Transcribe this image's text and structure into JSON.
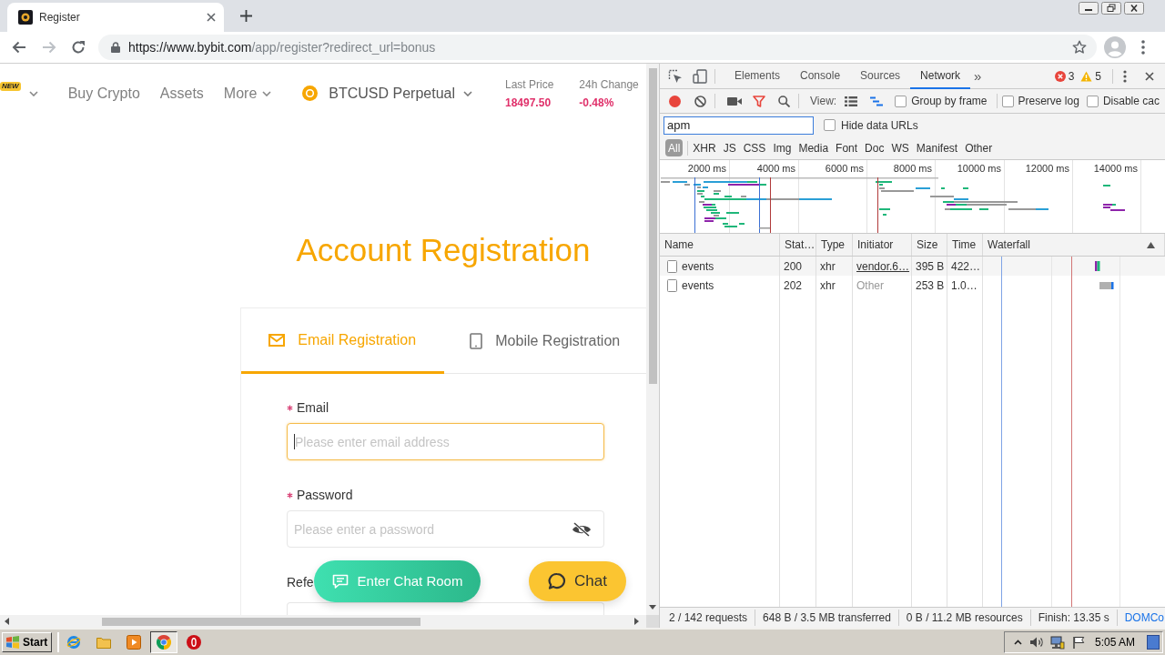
{
  "browser": {
    "tab": {
      "title": "Register"
    },
    "address": {
      "origin": "https://www.bybit.com",
      "path": "/app/register?redirect_url=bonus"
    }
  },
  "site_header": {
    "badge": "NEW",
    "links": [
      {
        "label": "Buy Crypto",
        "dropdown": false
      },
      {
        "label": "Assets",
        "dropdown": false
      },
      {
        "label": "More",
        "dropdown": true
      }
    ],
    "market": {
      "label": "BTCUSD Perpetual"
    },
    "stats": [
      {
        "label": "Last Price",
        "value": "18497.50"
      },
      {
        "label": "24h Change",
        "value": "-0.48%"
      }
    ]
  },
  "registration": {
    "title": "Account Registration",
    "tabs": [
      {
        "kind": "email",
        "label": "Email Registration",
        "selected": true
      },
      {
        "kind": "mobile",
        "label": "Mobile Registration",
        "selected": false
      }
    ],
    "fields": [
      {
        "kind": "text",
        "label": "Email",
        "required": true,
        "placeholder": "Please enter email address",
        "focused": true
      },
      {
        "kind": "password",
        "label": "Password",
        "required": true,
        "placeholder": "Please enter a password",
        "focused": false
      },
      {
        "kind": "text",
        "label": "Refe",
        "required": false,
        "focused": false
      }
    ]
  },
  "chat_buttons": [
    {
      "kind": "room",
      "label": "Enter Chat Room"
    },
    {
      "kind": "chat",
      "label": "Chat"
    }
  ],
  "devtools": {
    "tabs": [
      {
        "label": "Elements",
        "selected": false
      },
      {
        "label": "Console",
        "selected": false
      },
      {
        "label": "Sources",
        "selected": false
      },
      {
        "label": "Network",
        "selected": true
      }
    ],
    "more_tabs": "»",
    "errors": "3",
    "warnings": "5",
    "recording": true,
    "view_label": "View:",
    "view_toggles": [
      {
        "kind": "rows",
        "on": false
      },
      {
        "kind": "overview",
        "on": true
      }
    ],
    "options": [
      {
        "label": "Group by frame",
        "checked": false
      },
      {
        "label": "Preserve log",
        "checked": false
      },
      {
        "label": "Disable cac",
        "checked": false
      }
    ],
    "filter": {
      "value": "apm"
    },
    "hide_data_urls": {
      "label": "Hide data URLs",
      "checked": false
    },
    "type_filters": [
      {
        "label": "All",
        "selected": true
      },
      {
        "label": "XHR",
        "selected": false
      },
      {
        "label": "JS",
        "selected": false
      },
      {
        "label": "CSS",
        "selected": false
      },
      {
        "label": "Img",
        "selected": false
      },
      {
        "label": "Media",
        "selected": false
      },
      {
        "label": "Font",
        "selected": false
      },
      {
        "label": "Doc",
        "selected": false
      },
      {
        "label": "WS",
        "selected": false
      },
      {
        "label": "Manifest",
        "selected": false
      },
      {
        "label": "Other",
        "selected": false
      }
    ],
    "overview": {
      "ticks": [
        "2000 ms",
        "4000 ms",
        "6000 ms",
        "8000 ms",
        "10000 ms",
        "12000 ms",
        "14000 ms"
      ]
    },
    "table": {
      "columns": [
        "Name",
        "Stat…",
        "Type",
        "Initiator",
        "Size",
        "Time",
        "Waterfall"
      ],
      "rows": [
        {
          "name": "events",
          "status": "200",
          "type": "xhr",
          "initiator": {
            "kind": "link",
            "text": "vendor.6…"
          },
          "size": "395 B",
          "time": "422…"
        },
        {
          "name": "events",
          "status": "202",
          "type": "xhr",
          "initiator": {
            "kind": "other",
            "text": "Other"
          },
          "size": "253 B",
          "time": "1.0…"
        }
      ]
    },
    "status_bar": [
      {
        "kind": "plain",
        "text": "2 / 142 requests"
      },
      {
        "kind": "plain",
        "text": "648 B / 3.5 MB transferred"
      },
      {
        "kind": "plain",
        "text": "0 B / 11.2 MB resources"
      },
      {
        "kind": "plain",
        "text": "Finish: 13.35 s"
      },
      {
        "kind": "highlight",
        "text": "DOMCo"
      }
    ]
  },
  "taskbar": {
    "start": "Start",
    "apps": [
      {
        "kind": "globe",
        "active": false
      },
      {
        "kind": "folder",
        "active": false
      },
      {
        "kind": "player",
        "active": false
      },
      {
        "kind": "wheel",
        "active": true
      },
      {
        "kind": "ring",
        "active": false
      }
    ],
    "clock": "5:05 AM"
  }
}
